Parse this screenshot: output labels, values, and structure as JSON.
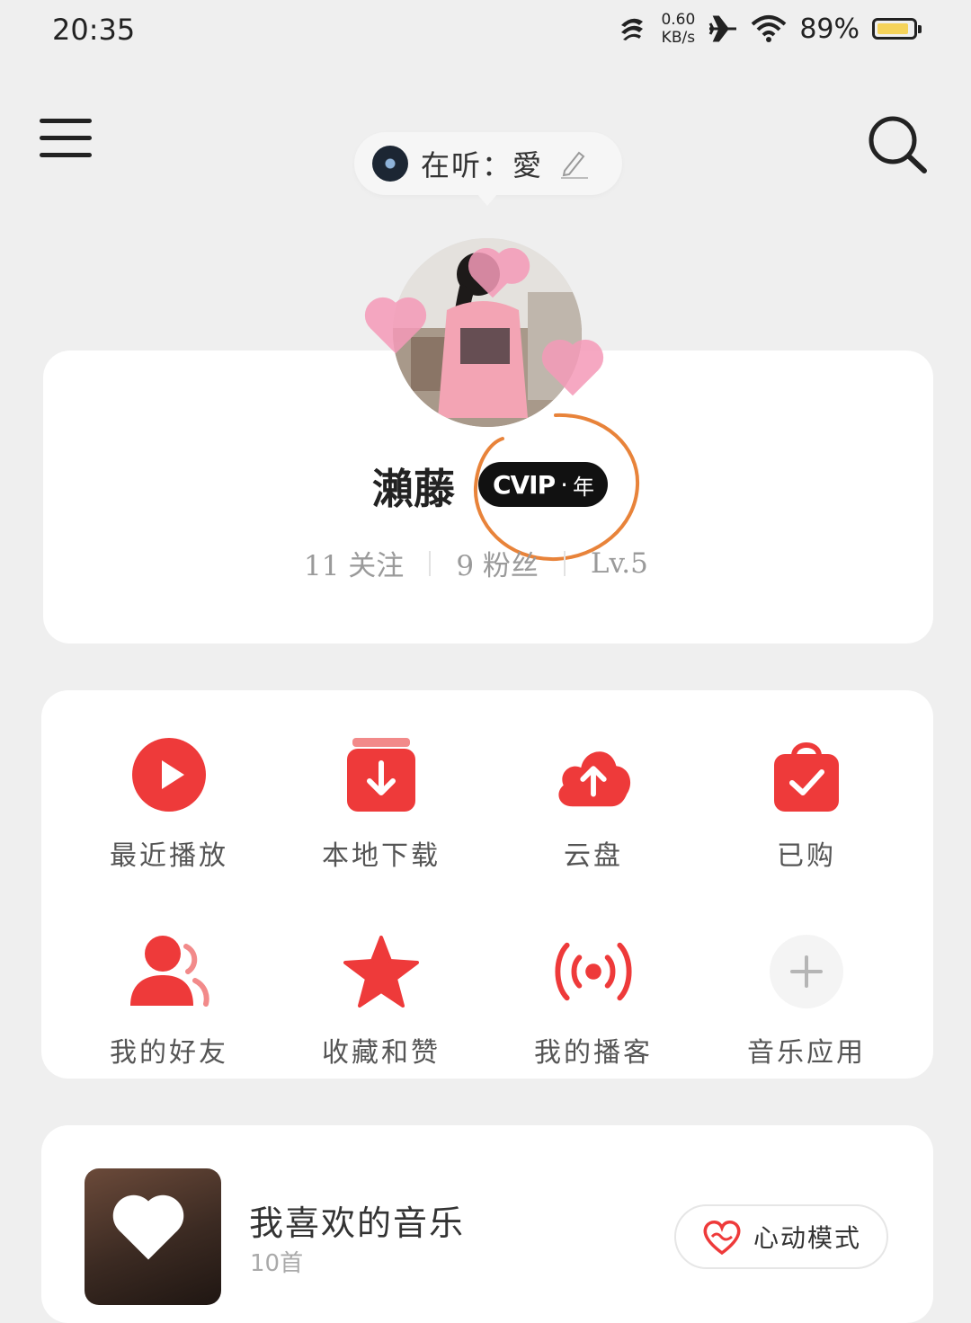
{
  "status_bar": {
    "time": "20:35",
    "net_speed_value": "0.60",
    "net_speed_unit": "KB/s",
    "battery_percent": "89%",
    "icons": [
      "data-saver-icon",
      "airplane-icon",
      "wifi-icon",
      "battery-icon"
    ]
  },
  "header": {
    "menu_icon": "menu-icon",
    "search_icon": "search-icon"
  },
  "now_listening": {
    "label": "在听：",
    "song": "愛"
  },
  "profile": {
    "username": "瀨藤",
    "vip_text": "CVIP",
    "vip_dot": "·",
    "vip_period": "年",
    "following": "11 关注",
    "followers": "9 粉丝",
    "level": "Lv.5"
  },
  "quick_grid": {
    "items": [
      {
        "label": "最近播放",
        "icon": "play-circle-icon"
      },
      {
        "label": "本地下载",
        "icon": "download-icon"
      },
      {
        "label": "云盘",
        "icon": "cloud-upload-icon"
      },
      {
        "label": "已购",
        "icon": "shopping-bag-icon"
      },
      {
        "label": "我的好友",
        "icon": "friends-icon"
      },
      {
        "label": "收藏和赞",
        "icon": "star-icon"
      },
      {
        "label": "我的播客",
        "icon": "podcast-icon"
      },
      {
        "label": "音乐应用",
        "icon": "add-icon"
      }
    ]
  },
  "liked_music": {
    "title": "我喜欢的音乐",
    "count": "10首",
    "heart_mode_label": "心动模式"
  },
  "colors": {
    "accent": "#ee3a3a",
    "annotation": "#e8833a",
    "background": "#efefef"
  }
}
